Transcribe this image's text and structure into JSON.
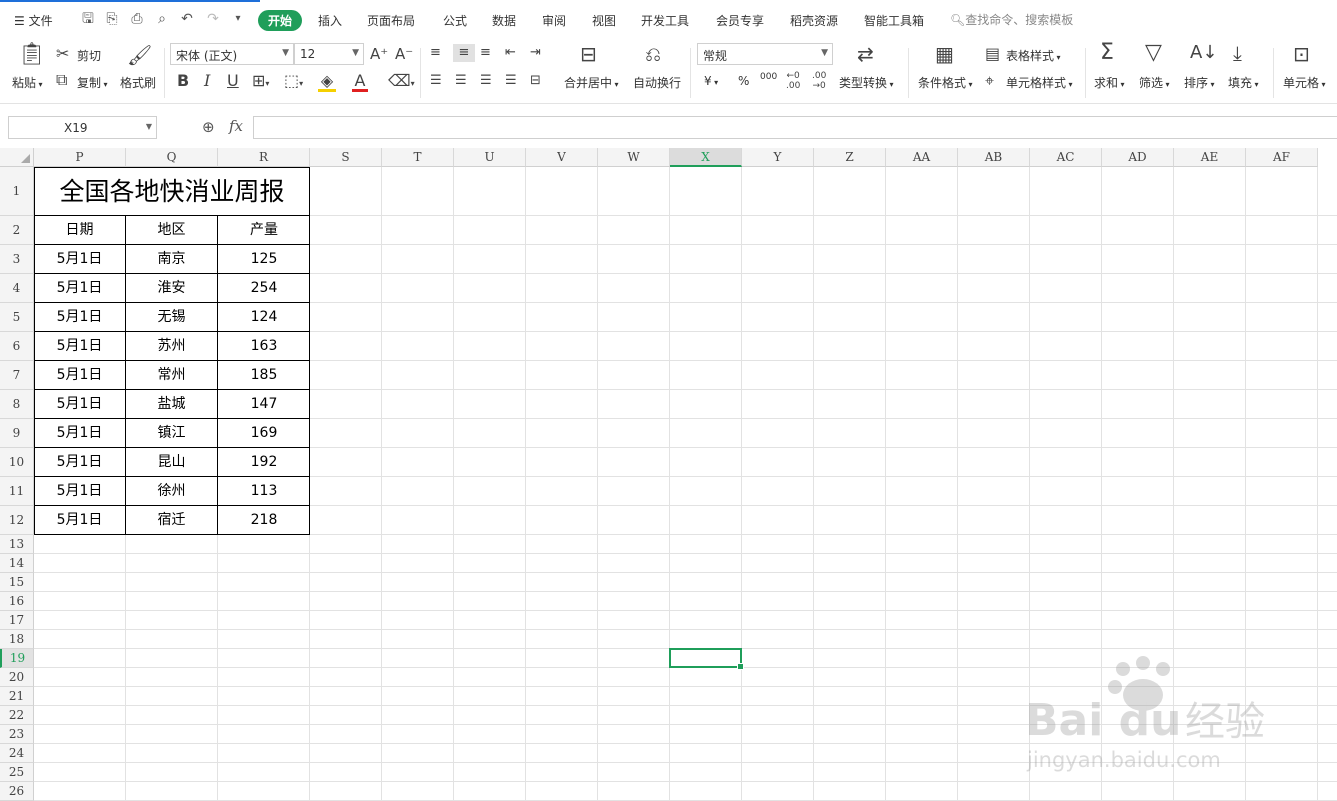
{
  "menubar": {
    "file": "文件",
    "tabs": [
      "开始",
      "插入",
      "页面布局",
      "公式",
      "数据",
      "审阅",
      "视图",
      "开发工具",
      "会员专享",
      "稻壳资源",
      "智能工具箱"
    ],
    "search": "查找命令、搜索模板"
  },
  "ribbon": {
    "paste": "粘贴",
    "cut": "剪切",
    "copy": "复制",
    "format_painter": "格式刷",
    "font_name": "宋体 (正文)",
    "font_size": "12",
    "merge_center": "合并居中",
    "wrap": "自动换行",
    "number_format": "常规",
    "currency": "¥",
    "percent": "%",
    "thousands": "000",
    "type_convert": "类型转换",
    "cond_format": "条件格式",
    "table_style": "表格样式",
    "cell_style": "单元格样式",
    "sum": "求和",
    "filter": "筛选",
    "sort": "排序",
    "fill": "填充",
    "cell": "单元格"
  },
  "formula_bar": {
    "name_box": "X19",
    "fx": "fx",
    "content": ""
  },
  "sheet": {
    "columns": [
      "P",
      "Q",
      "R",
      "S",
      "T",
      "U",
      "V",
      "W",
      "X",
      "Y",
      "Z",
      "AA",
      "AB",
      "AC",
      "AD",
      "AE",
      "AF"
    ],
    "rows": [
      "1",
      "2",
      "3",
      "4",
      "5",
      "6",
      "7",
      "8",
      "9",
      "10",
      "11",
      "12",
      "13",
      "14",
      "15",
      "16",
      "17",
      "18",
      "19",
      "20",
      "21",
      "22",
      "23",
      "24",
      "25",
      "26"
    ],
    "title": "全国各地快消业周报",
    "headers": [
      "日期",
      "地区",
      "产量"
    ],
    "data": [
      [
        "5月1日",
        "南京",
        "125"
      ],
      [
        "5月1日",
        "淮安",
        "254"
      ],
      [
        "5月1日",
        "无锡",
        "124"
      ],
      [
        "5月1日",
        "苏州",
        "163"
      ],
      [
        "5月1日",
        "常州",
        "185"
      ],
      [
        "5月1日",
        "盐城",
        "147"
      ],
      [
        "5月1日",
        "镇江",
        "169"
      ],
      [
        "5月1日",
        "昆山",
        "192"
      ],
      [
        "5月1日",
        "徐州",
        "113"
      ],
      [
        "5月1日",
        "宿迁",
        "218"
      ]
    ],
    "selected_col": "X",
    "selected_row": "19"
  },
  "watermark": {
    "brand": "Bai du",
    "cn": "经验",
    "url": "jingyan.baidu.com"
  },
  "colors": {
    "accent": "#1f9e5a"
  }
}
